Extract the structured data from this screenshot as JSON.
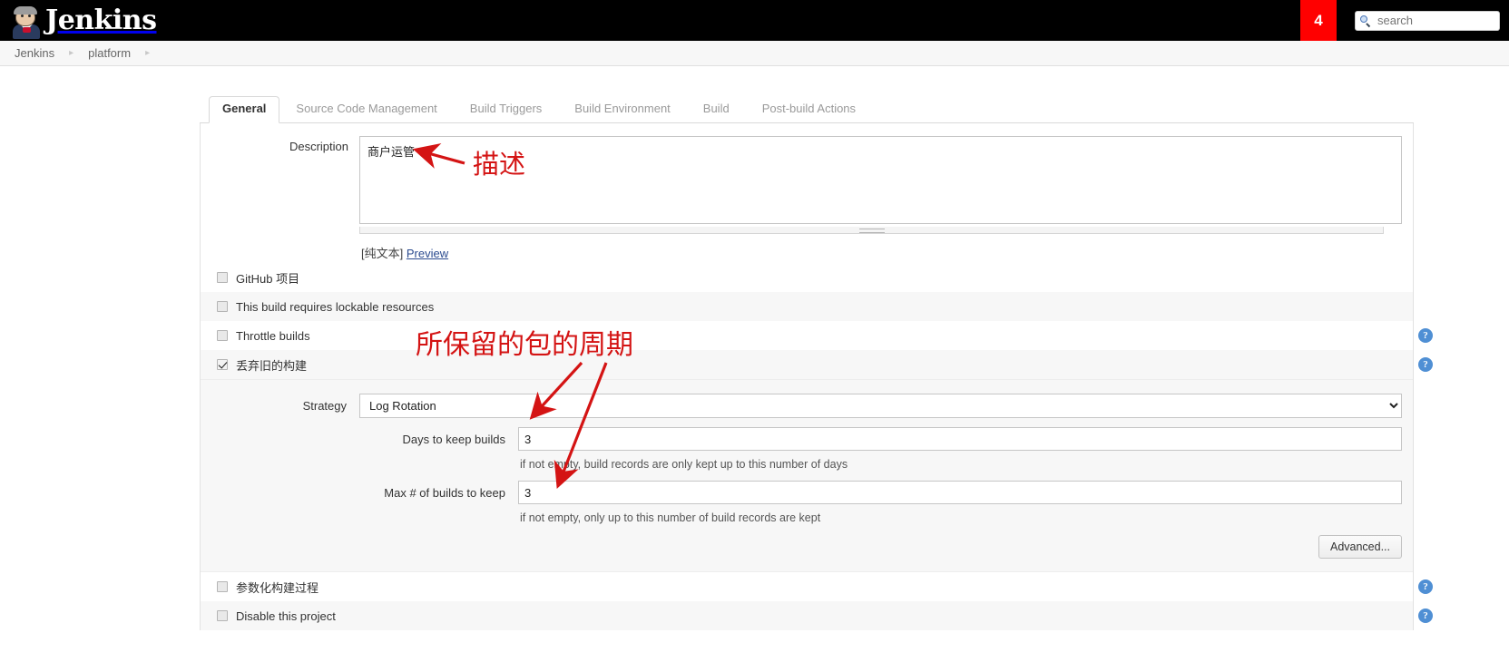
{
  "header": {
    "brand": "Jenkins",
    "logo_icon": "jenkins-butler-icon",
    "alert_count": "4",
    "search_placeholder": "search",
    "search_icon": "search-icon"
  },
  "breadcrumb": {
    "items": [
      {
        "label": "Jenkins"
      },
      {
        "label": "platform"
      }
    ],
    "separator": "▸"
  },
  "tabs": [
    {
      "label": "General",
      "active": true
    },
    {
      "label": "Source Code Management",
      "active": false
    },
    {
      "label": "Build Triggers",
      "active": false
    },
    {
      "label": "Build Environment",
      "active": false
    },
    {
      "label": "Build",
      "active": false
    },
    {
      "label": "Post-build Actions",
      "active": false
    }
  ],
  "form": {
    "description": {
      "label": "Description",
      "value": "商户运管",
      "placeholder": ""
    },
    "preview": {
      "plain_text": "[纯文本]",
      "link": "Preview"
    },
    "checkboxes": [
      {
        "label": "GitHub 项目",
        "checked": false,
        "help": false
      },
      {
        "label": "This build requires lockable resources",
        "checked": false,
        "help": false
      },
      {
        "label": "Throttle builds",
        "checked": false,
        "help": true
      },
      {
        "label": "丢弃旧的构建",
        "checked": true,
        "help": true
      }
    ],
    "strategy": {
      "label": "Strategy",
      "value": "Log Rotation",
      "options": [
        "Log Rotation"
      ],
      "caret_icon": "chevron-down-icon"
    },
    "days_to_keep": {
      "label": "Days to keep builds",
      "value": "3",
      "hint": "if not empty, build records are only kept up to this number of days"
    },
    "max_builds": {
      "label": "Max # of builds to keep",
      "value": "3",
      "hint": "if not empty, only up to this number of build records are kept"
    },
    "advanced_button": "Advanced...",
    "bottom_checkboxes": [
      {
        "label": "参数化构建过程",
        "checked": false,
        "help": true
      },
      {
        "label": "Disable this project",
        "checked": false,
        "help": true
      }
    ]
  },
  "annotations": {
    "color": "#d41414",
    "description_note": "描述",
    "retention_note": "所保留的包的周期"
  },
  "help_icon_glyph": "?"
}
